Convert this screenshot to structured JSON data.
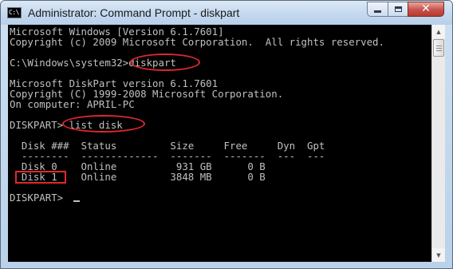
{
  "window": {
    "title": "Administrator: Command Prompt - diskpart",
    "app_icon_text": "C:\\",
    "icons": {
      "app": "cmd-icon",
      "minimize": "minimize-icon",
      "maximize": "maximize-icon",
      "close": "close-icon"
    }
  },
  "console": {
    "lines": [
      "Microsoft Windows [Version 6.1.7601]",
      "Copyright (c) 2009 Microsoft Corporation.  All rights reserved.",
      "",
      "C:\\Windows\\system32>diskpart",
      "",
      "Microsoft DiskPart version 6.1.7601",
      "Copyright (C) 1999-2008 Microsoft Corporation.",
      "On computer: APRIL-PC",
      "",
      "DISKPART> list disk",
      "",
      "  Disk ###  Status         Size     Free     Dyn  Gpt",
      "  --------  -------------  -------  -------  ---  ---",
      "  Disk 0    Online          931 GB      0 B",
      "  Disk 1    Online         3848 MB      0 B",
      "",
      "DISKPART> "
    ]
  },
  "colors": {
    "console_background": "#000000",
    "console_text": "#c0c0c0",
    "highlight_annotation": "#e0282e",
    "close_button": "#c75050"
  }
}
